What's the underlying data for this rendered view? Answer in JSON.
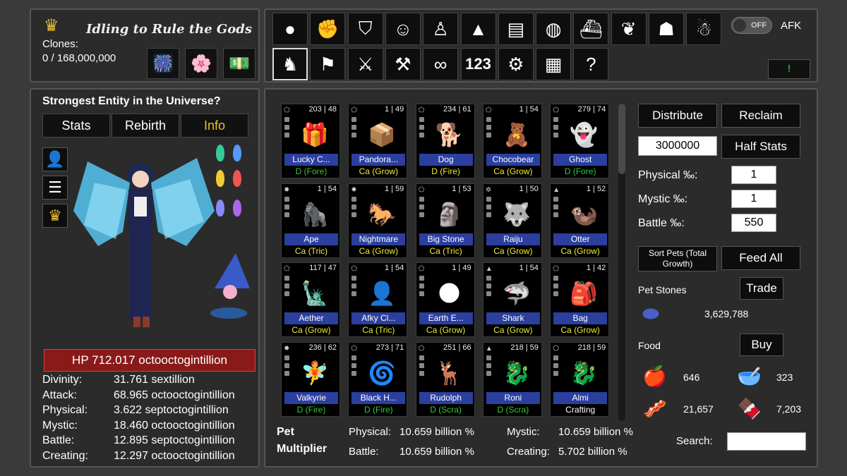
{
  "header": {
    "title": "Idling to Rule the Gods",
    "clones_label": "Clones:",
    "clones_value": "0 / 168,000,000",
    "buttons": [
      {
        "icon": "firework-icon",
        "glyph": "🎆"
      },
      {
        "icon": "lotus-icon",
        "glyph": "🌸"
      },
      {
        "icon": "money-icon",
        "glyph": "💵"
      }
    ]
  },
  "toolbar": {
    "row1": [
      {
        "name": "light-orb-icon",
        "glyph": "●"
      },
      {
        "name": "fist-icon",
        "glyph": "✊"
      },
      {
        "name": "shield-icon",
        "glyph": "⛉"
      },
      {
        "name": "slime-icon",
        "glyph": "☺"
      },
      {
        "name": "aura-man-icon",
        "glyph": "♙"
      },
      {
        "name": "pyramid-icon",
        "glyph": "▲"
      },
      {
        "name": "scroll-map-icon",
        "glyph": "▤"
      },
      {
        "name": "planet-icon",
        "glyph": "◍"
      },
      {
        "name": "ship-icon",
        "glyph": "⛴"
      },
      {
        "name": "bat-wings-icon",
        "glyph": "❦"
      },
      {
        "name": "people-icon",
        "glyph": "☗"
      },
      {
        "name": "bird-icon",
        "glyph": "☃"
      }
    ],
    "row2": [
      {
        "name": "cat-icon",
        "glyph": "♞",
        "active": true
      },
      {
        "name": "flag-icon",
        "glyph": "⚑"
      },
      {
        "name": "crossed-swords-icon",
        "glyph": "⚔"
      },
      {
        "name": "anvil-icon",
        "glyph": "⚒"
      },
      {
        "name": "infinity-icon",
        "glyph": "∞"
      },
      {
        "name": "counter-icon",
        "glyph": "123"
      },
      {
        "name": "gears-icon",
        "glyph": "⚙"
      },
      {
        "name": "book-icon",
        "glyph": "▦"
      },
      {
        "name": "help-icon",
        "glyph": "?"
      }
    ],
    "toggle_label": "OFF",
    "afk_label": "AFK",
    "alert_label": "!"
  },
  "entity": {
    "title": "Strongest Entity in the Universe?",
    "tabs": [
      "Stats",
      "Rebirth",
      "Info"
    ],
    "hp": "HP 712.017 octooctogintillion",
    "stats": [
      {
        "label": "Divinity:",
        "value": "31.761 sextillion"
      },
      {
        "label": "Attack:",
        "value": "68.965 octooctogintillion"
      },
      {
        "label": "Physical:",
        "value": "3.622 septoctogintillion"
      },
      {
        "label": "Mystic:",
        "value": "18.460 octooctogintillion"
      },
      {
        "label": "Battle:",
        "value": "12.895 septoctogintillion"
      },
      {
        "label": "Creating:",
        "value": "12.297 octooctogintillion"
      }
    ]
  },
  "pets": [
    {
      "name": "Lucky C...",
      "level": "203 | 48",
      "cls": "D (Fore)",
      "color": "#3c3",
      "glyph": "🎁",
      "elem": "⬠"
    },
    {
      "name": "Pandora...",
      "level": "1 | 49",
      "cls": "Ca (Grow)",
      "color": "#ee3",
      "glyph": "📦",
      "elem": "⬠"
    },
    {
      "name": "Dog",
      "level": "234 | 61",
      "cls": "D (Fire)",
      "color": "#ee3",
      "glyph": "🐕",
      "elem": "⬠"
    },
    {
      "name": "Chocobear",
      "level": "1 | 54",
      "cls": "Ca (Grow)",
      "color": "#ee3",
      "glyph": "🧸",
      "elem": "⬠"
    },
    {
      "name": "Ghost",
      "level": "279 | 74",
      "cls": "D (Fore)",
      "color": "#3c3",
      "glyph": "👻",
      "elem": "⬠"
    },
    {
      "name": "Ape",
      "level": "1 | 54",
      "cls": "Ca (Tric)",
      "color": "#ee3",
      "glyph": "🦍",
      "elem": "✹"
    },
    {
      "name": "Nightmare",
      "level": "1 | 59",
      "cls": "Ca (Grow)",
      "color": "#ee3",
      "glyph": "🐎",
      "elem": "✹"
    },
    {
      "name": "Big Stone",
      "level": "1 | 53",
      "cls": "Ca (Tric)",
      "color": "#ee3",
      "glyph": "🗿",
      "elem": "⬠"
    },
    {
      "name": "Raiju",
      "level": "1 | 50",
      "cls": "Ca (Grow)",
      "color": "#ee3",
      "glyph": "🐺",
      "elem": "✲"
    },
    {
      "name": "Otter",
      "level": "1 | 52",
      "cls": "Ca (Grow)",
      "color": "#ee3",
      "glyph": "🦦",
      "elem": "▲"
    },
    {
      "name": "Aether",
      "level": "117 | 47",
      "cls": "Ca (Grow)",
      "color": "#ee3",
      "glyph": "🗽",
      "elem": "⬠"
    },
    {
      "name": "Afky Cl...",
      "level": "1 | 54",
      "cls": "Ca (Tric)",
      "color": "#ee3",
      "glyph": "👤",
      "elem": "⬠"
    },
    {
      "name": "Earth E...",
      "level": "1 | 49",
      "cls": "Ca (Grow)",
      "color": "#ee3",
      "glyph": "🌑",
      "elem": "⬠"
    },
    {
      "name": "Shark",
      "level": "1 | 54",
      "cls": "Ca (Grow)",
      "color": "#ee3",
      "glyph": "🦈",
      "elem": "▲"
    },
    {
      "name": "Bag",
      "level": "1 | 42",
      "cls": "Ca (Grow)",
      "color": "#ee3",
      "glyph": "🎒",
      "elem": "⬠"
    },
    {
      "name": "Valkyrie",
      "level": "236 | 62",
      "cls": "D (Fire)",
      "color": "#3c3",
      "glyph": "🧚",
      "elem": "✹"
    },
    {
      "name": "Black H...",
      "level": "273 | 71",
      "cls": "D (Fire)",
      "color": "#3c3",
      "glyph": "🌀",
      "elem": "⬠"
    },
    {
      "name": "Rudolph",
      "level": "251 | 66",
      "cls": "D (Scra)",
      "color": "#3c3",
      "glyph": "🦌",
      "elem": "⬠"
    },
    {
      "name": "Roni",
      "level": "218 | 59",
      "cls": "D (Scra)",
      "color": "#3c3",
      "glyph": "🐉",
      "elem": "▲"
    },
    {
      "name": "Almi",
      "level": "218 | 59",
      "cls": "Crafting",
      "color": "#fff",
      "glyph": "🐉",
      "elem": "⬠"
    }
  ],
  "multiplier": {
    "label_line1": "Pet",
    "label_line2": "Multiplier",
    "physical_label": "Physical:",
    "physical_value": "10.659 billion %",
    "mystic_label": "Mystic:",
    "mystic_value": "10.659 billion %",
    "battle_label": "Battle:",
    "battle_value": "10.659 billion %",
    "creating_label": "Creating:",
    "creating_value": "5.702 billion %"
  },
  "right": {
    "distribute": "Distribute",
    "reclaim": "Reclaim",
    "amount": "3000000",
    "half_stats": "Half Stats",
    "physical_label": "Physical ‰:",
    "physical_value": "1",
    "mystic_label": "Mystic ‰:",
    "mystic_value": "1",
    "battle_label": "Battle ‰:",
    "battle_value": "550",
    "sort_pets": "Sort Pets (Total Growth)",
    "feed_all": "Feed All",
    "pet_stones_label": "Pet Stones",
    "trade": "Trade",
    "pet_stones_value": "3,629,788",
    "food_label": "Food",
    "buy": "Buy",
    "food": [
      {
        "name": "apple-egg-icon",
        "glyph": "🍎",
        "count": "646"
      },
      {
        "name": "bowl-icon",
        "glyph": "🥣",
        "count": "323"
      },
      {
        "name": "bacon-icon",
        "glyph": "🥓",
        "count": "21,657"
      },
      {
        "name": "chocolates-icon",
        "glyph": "🍫",
        "count": "7,203"
      }
    ],
    "search_label": "Search:",
    "search_value": ""
  }
}
